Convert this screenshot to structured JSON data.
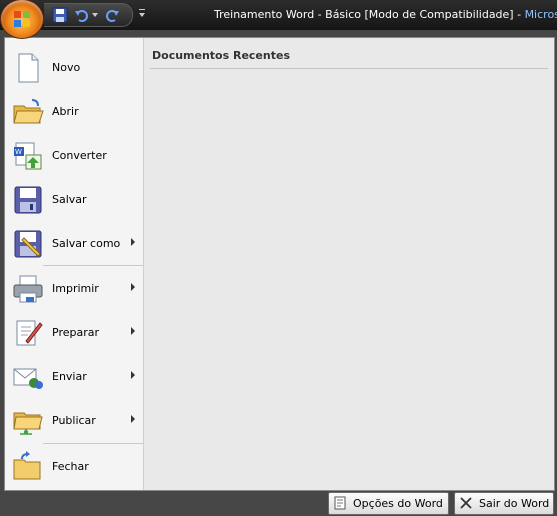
{
  "titlebar": {
    "doc_title": "Treinamento Word - Básico [Modo de Compatibilidade] - ",
    "app_name": "Microsoft"
  },
  "office_menu": {
    "commands": [
      {
        "id": "novo",
        "label": "Novo",
        "icon": "new-document-icon",
        "has_submenu": false
      },
      {
        "id": "abrir",
        "label": "Abrir",
        "icon": "open-folder-icon",
        "has_submenu": false
      },
      {
        "id": "converter",
        "label": "Converter",
        "icon": "convert-icon",
        "has_submenu": false
      },
      {
        "id": "salvar",
        "label": "Salvar",
        "icon": "save-icon",
        "has_submenu": false
      },
      {
        "id": "salvar-como",
        "label": "Salvar como",
        "icon": "save-as-icon",
        "has_submenu": true
      },
      {
        "id": "imprimir",
        "label": "Imprimir",
        "icon": "printer-icon",
        "has_submenu": true
      },
      {
        "id": "preparar",
        "label": "Preparar",
        "icon": "prepare-icon",
        "has_submenu": true
      },
      {
        "id": "enviar",
        "label": "Enviar",
        "icon": "send-icon",
        "has_submenu": true
      },
      {
        "id": "publicar",
        "label": "Publicar",
        "icon": "publish-icon",
        "has_submenu": true
      },
      {
        "id": "fechar",
        "label": "Fechar",
        "icon": "close-folder-icon",
        "has_submenu": false
      }
    ],
    "recent": {
      "title": "Documentos Recentes"
    },
    "buttons": {
      "options": "Opções do Word",
      "exit": "Sair do Word"
    }
  }
}
